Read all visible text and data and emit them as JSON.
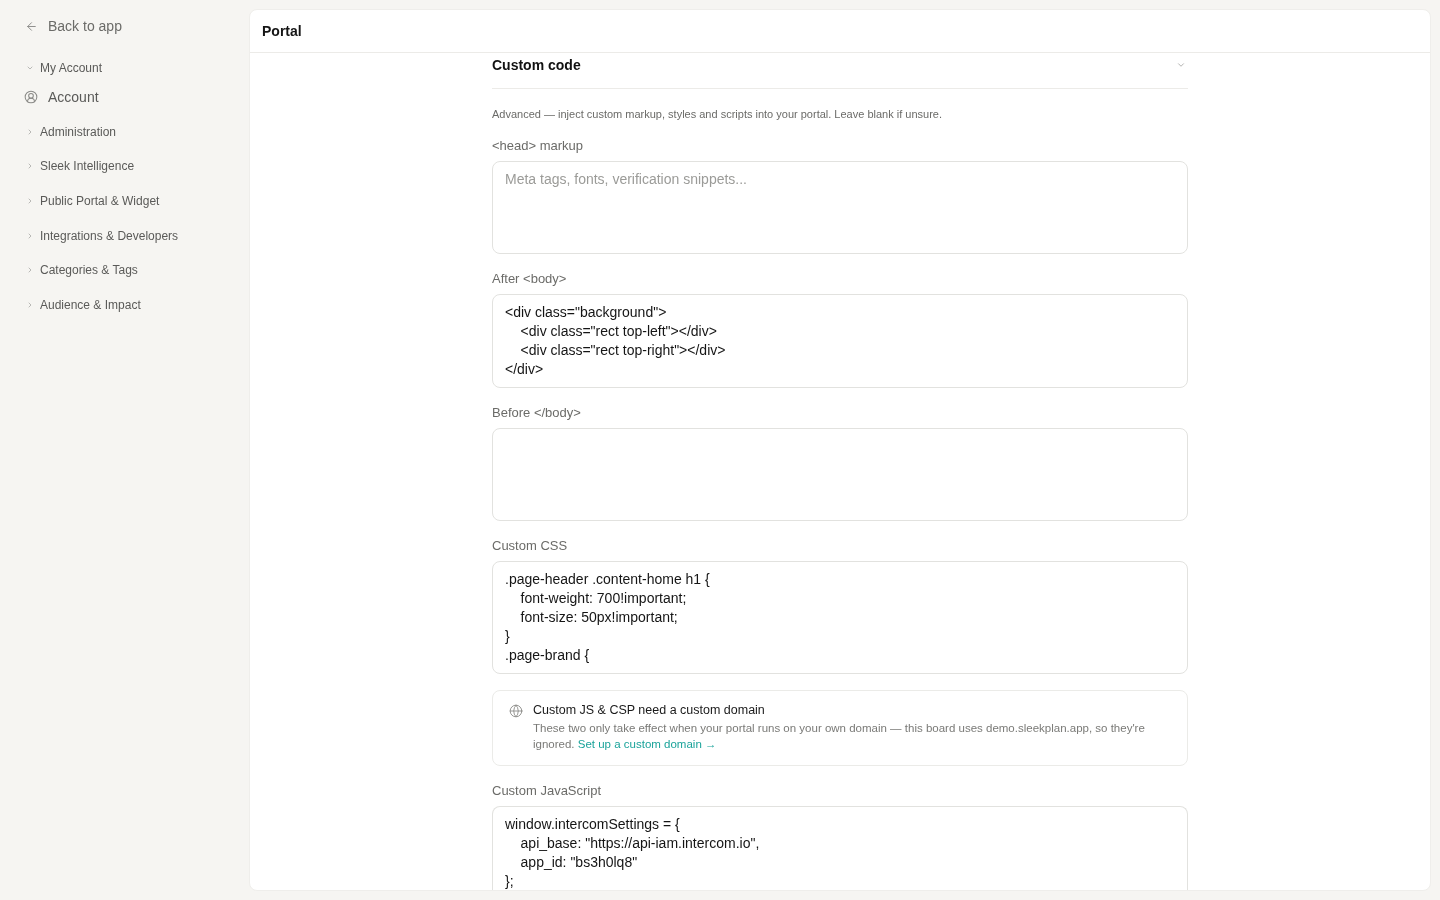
{
  "sidebar": {
    "back_link": "Back to app",
    "sections": [
      {
        "label": "My Account",
        "expanded": true,
        "children": [
          {
            "label": "Account"
          }
        ]
      },
      {
        "label": "Administration",
        "expanded": false
      },
      {
        "label": "Sleek Intelligence",
        "expanded": false
      },
      {
        "label": "Public Portal & Widget",
        "expanded": false
      },
      {
        "label": "Integrations & Developers",
        "expanded": false
      },
      {
        "label": "Categories & Tags",
        "expanded": false
      },
      {
        "label": "Audience & Impact",
        "expanded": false
      }
    ]
  },
  "header": {
    "title": "Portal"
  },
  "section": {
    "title": "Custom code",
    "expanded": true,
    "description": "Advanced — inject custom markup, styles and scripts into your portal. Leave blank if unsure.",
    "items": [
      {
        "kind": "field",
        "label": "<head> markup",
        "placeholder": "Meta tags, fonts, verification snippets..."
      },
      {
        "kind": "field",
        "label": "After <body>",
        "value": "<div class=\"background\">\n    <div class=\"rect top-left\"></div>\n    <div class=\"rect top-right\"></div>\n</div>"
      },
      {
        "kind": "field",
        "label": "Before </body>"
      },
      {
        "kind": "field",
        "label": "Custom CSS",
        "value": ".page-header .content-home h1 {\n    font-weight: 700!important;\n    font-size: 50px!important;\n}\n.page-brand {"
      },
      {
        "kind": "notice",
        "title": "Custom JS & CSP need a custom domain",
        "text": "These two only take effect when your portal runs on your own domain — this board uses demo.sleekplan.app, so they're ignored.",
        "link": "Set up a custom domain →"
      },
      {
        "kind": "field",
        "label": "Custom JavaScript",
        "value": "window.intercomSettings = {\n    api_base: \"https://api-iam.intercom.io\",\n    app_id: \"bs3h0lq8\"\n};"
      }
    ]
  }
}
